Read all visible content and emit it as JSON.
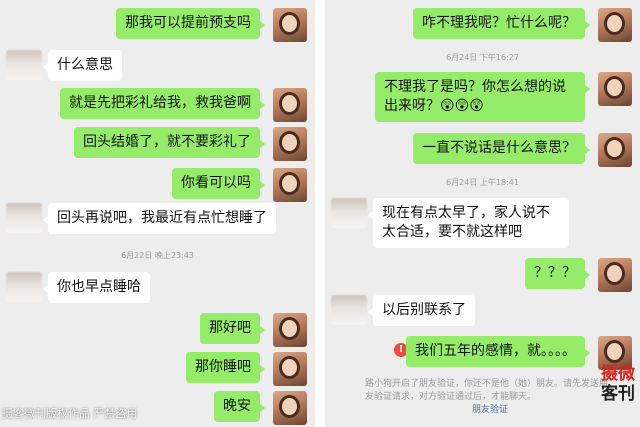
{
  "left_panel": {
    "messages": [
      {
        "side": "me",
        "text": "那我可以提前预支吗"
      },
      {
        "side": "other",
        "text": "什么意思"
      },
      {
        "side": "me",
        "text": "就是先把彩礼给我，救我爸啊"
      },
      {
        "side": "me",
        "text": "回头结婚了，就不要彩礼了"
      },
      {
        "side": "me",
        "text": "你看可以吗"
      },
      {
        "side": "other",
        "text": "回头再说吧，我最近有点忙想睡了"
      },
      {
        "side": "other",
        "text": "你也早点睡哈"
      },
      {
        "side": "me",
        "text": "那好吧"
      },
      {
        "side": "me",
        "text": "那你睡吧"
      },
      {
        "side": "me",
        "text": "晚安"
      }
    ],
    "timestamps": [
      "6月22日 晚上23:43"
    ]
  },
  "right_panel": {
    "messages": [
      {
        "side": "me",
        "text": "咋不理我呢？忙什么呢？"
      },
      {
        "side": "me",
        "text": "不理我了是吗？你怎么想的说出来呀？😲😲😲"
      },
      {
        "side": "me",
        "text": "一直不说话是什么意思？"
      },
      {
        "side": "other",
        "text": "现在有点太早了，家人说不太合适，要不就这样吧"
      },
      {
        "side": "me",
        "text": "？？？"
      },
      {
        "side": "other",
        "text": "以后别联系了"
      },
      {
        "side": "me",
        "text": "我们五年的感情，就。。。。",
        "failed": true
      }
    ],
    "timestamps": [
      "6月24日 下午16:27",
      "6月24日 上午18:41"
    ],
    "system_note": {
      "text": "路小狗开启了朋友验证，你还不是他（她）朋友。请先发送朋友验证请求，对方验证通过后，才能聊天。",
      "link": "朋友验证"
    },
    "fail_icon_symbol": "!"
  },
  "watermark": {
    "text": "摄客微刊版权作品 严禁盗用",
    "logo_line1": "摄微",
    "logo_line2": "客刊"
  },
  "colors": {
    "my_bubble": "#95ec69",
    "other_bubble": "#ffffff",
    "chat_background": "#ededed",
    "fail_icon": "#f04a3d",
    "link": "#576b95"
  }
}
